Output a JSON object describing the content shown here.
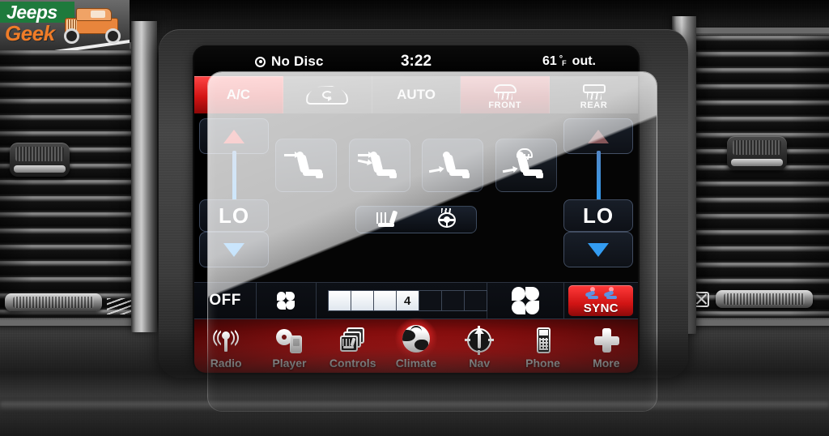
{
  "watermark": {
    "line1": "Jeeps",
    "line2": "Geek",
    "vehicle_icon": "jeep-vehicle-icon"
  },
  "status_bar": {
    "disc_icon": "disc-icon",
    "disc_status": "No Disc",
    "clock": "3:22",
    "outside_temp_value": "61",
    "degree_symbol": "°",
    "temp_unit": "F",
    "temp_suffix": "out."
  },
  "climate_top_row": [
    {
      "label": "A/C",
      "icon": "ac-label",
      "active": true
    },
    {
      "label": "",
      "icon": "recirculation-icon",
      "active": false
    },
    {
      "label": "AUTO",
      "icon": "auto-label",
      "active": false
    },
    {
      "label": "FRONT",
      "icon": "front-defrost-icon",
      "active": true
    },
    {
      "label": "REAR",
      "icon": "rear-defrost-icon",
      "active": false
    }
  ],
  "temperature": {
    "left": {
      "up_icon": "temp-up-arrow-icon",
      "value": "LO",
      "down_icon": "temp-down-arrow-icon"
    },
    "right": {
      "up_icon": "temp-up-arrow-icon",
      "value": "LO",
      "down_icon": "temp-down-arrow-icon"
    }
  },
  "airflow_modes": [
    {
      "icon": "airflow-face-icon",
      "name": "face"
    },
    {
      "icon": "airflow-face-feet-icon",
      "name": "face-and-feet"
    },
    {
      "icon": "airflow-feet-icon",
      "name": "feet"
    },
    {
      "icon": "airflow-feet-defrost-icon",
      "name": "feet-and-defrost"
    }
  ],
  "heat_row": [
    {
      "icon": "heated-seat-icon",
      "name": "heated-seat"
    },
    {
      "icon": "heated-steering-wheel-icon",
      "name": "heated-steering-wheel"
    }
  ],
  "fan_row": {
    "off_label": "OFF",
    "fan_min_icon": "fan-decrease-icon",
    "fan_max_icon": "fan-increase-icon",
    "speed_value": "4",
    "total_segments": 7,
    "filled_segments": 4,
    "sync_label": "SYNC",
    "sync_icon": "sync-seats-icon",
    "sync_active": true
  },
  "nav_bar": [
    {
      "label": "Radio",
      "icon": "radio-icon",
      "active": false
    },
    {
      "label": "Player",
      "icon": "player-icon",
      "active": false
    },
    {
      "label": "Controls",
      "icon": "controls-icon",
      "active": false
    },
    {
      "label": "Climate",
      "icon": "climate-icon",
      "active": true
    },
    {
      "label": "Nav",
      "icon": "nav-compass-icon",
      "active": false
    },
    {
      "label": "Phone",
      "icon": "phone-icon",
      "active": false
    },
    {
      "label": "More",
      "icon": "more-plus-icon",
      "active": false
    }
  ],
  "colors": {
    "accent_red": "#d31414",
    "active_red": "#ff3636",
    "temp_cold_blue": "#2f9bf2",
    "temp_hot_red": "#e03030",
    "brand_green": "#1e7a3c",
    "brand_orange": "#ef7c28"
  }
}
